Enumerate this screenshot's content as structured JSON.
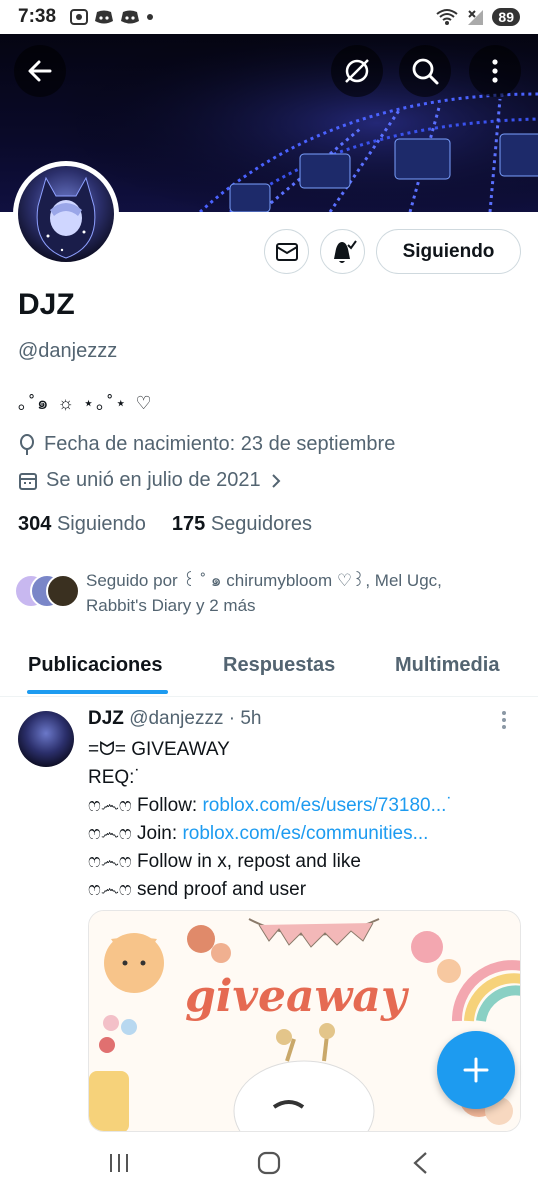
{
  "status_bar": {
    "time": "7:38",
    "battery": "89"
  },
  "profile": {
    "name": "DJZ",
    "handle": "@danjezzz",
    "bio": "｡˚๑ ☼ ⋆｡˚⋆ ♡",
    "birthday": "Fecha de nacimiento: 23 de septiembre",
    "joined": "Se unió en julio de 2021",
    "following_count": "304",
    "following_label": "Siguiendo",
    "followers_count": "175",
    "followers_label": "Seguidores",
    "follow_button": "Siguiendo",
    "followed_by": "Seguido por ꒰ ˚ ๑ chirumybloom ♡꒱, Mel Ugc, Rabbit's Diary y 2 más"
  },
  "tabs": [
    {
      "label": "Publicaciones",
      "active": true
    },
    {
      "label": "Respuestas",
      "active": false
    },
    {
      "label": "Multimedia",
      "active": false
    }
  ],
  "tweet": {
    "author": "DJZ",
    "handle_time": "@danjezzz · 5h",
    "line1": "=ᗢ= GIVEAWAY",
    "line2": "REQ:˙",
    "line3_prefix": "ෆ෴ෆ Follow: ",
    "line3_link": "roblox.com/es/users/73180...˙",
    "line4_prefix": "ෆ෴ෆ Join: ",
    "line4_link": "roblox.com/es/communities...",
    "line5": "ෆ෴ෆ Follow in x, repost and like",
    "line6": "ෆ෴ෆ send proof and user",
    "media_text": "giveaway"
  },
  "icons": {
    "back": "back-arrow-icon",
    "mute": "no-signal-icon",
    "search": "search-icon",
    "more": "more-vertical-icon",
    "message": "mail-icon",
    "notify": "bell-icon",
    "birthday": "balloon-icon",
    "calendar": "calendar-icon",
    "compose": "plus-icon"
  },
  "colors": {
    "accent": "#1d9bf0",
    "text": "#0f1419",
    "muted": "#536471"
  }
}
